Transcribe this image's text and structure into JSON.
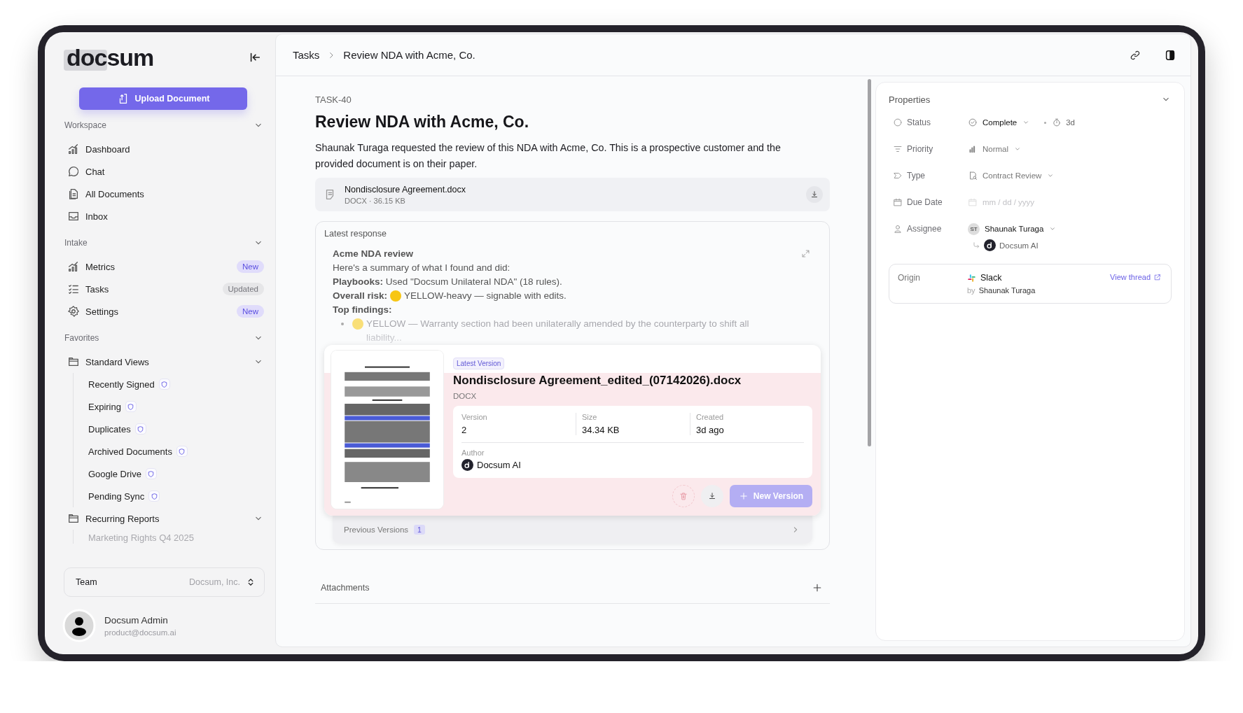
{
  "sidebar": {
    "logo": "docsum",
    "upload_button": "Upload Document",
    "sections": [
      {
        "title": "Workspace",
        "expanded": true,
        "items": [
          {
            "label": "Dashboard"
          },
          {
            "label": "Chat"
          },
          {
            "label": "All Documents"
          },
          {
            "label": "Inbox"
          }
        ]
      },
      {
        "title": "Intake",
        "expanded": true,
        "items": [
          {
            "label": "Metrics",
            "badge": {
              "text": "New",
              "kind": "new"
            }
          },
          {
            "label": "Tasks",
            "badge": {
              "text": "Updated",
              "kind": "updated"
            }
          },
          {
            "label": "Settings",
            "badge": {
              "text": "New",
              "kind": "new"
            }
          }
        ]
      }
    ],
    "favorites": {
      "title": "Favorites",
      "expanded": true,
      "groups": [
        {
          "label": "Standard Views",
          "expanded": true,
          "children": [
            {
              "label": "Recently Signed"
            },
            {
              "label": "Expiring"
            },
            {
              "label": "Duplicates"
            },
            {
              "label": "Archived Documents"
            },
            {
              "label": "Google Drive"
            },
            {
              "label": "Pending Sync"
            }
          ]
        },
        {
          "label": "Recurring Reports",
          "expanded": true,
          "children": [
            {
              "label": "Marketing Rights Q4 2025"
            }
          ]
        }
      ]
    },
    "team": {
      "label": "Team",
      "value": "Docsum, Inc."
    },
    "user": {
      "name": "Docsum Admin",
      "email": "product@docsum.ai"
    }
  },
  "breadcrumbs": [
    "Tasks",
    "Review NDA with Acme, Co."
  ],
  "task": {
    "id": "TASK-40",
    "title": "Review NDA with Acme, Co.",
    "description": "Shaunak Turaga requested the review of this NDA with Acme, Co. This is a prospective customer and the provided document is on their paper.",
    "attachment": {
      "name": "Nondisclosure Agreement.docx",
      "meta": "DOCX · 36.15 KB"
    }
  },
  "response": {
    "label": "Latest response",
    "title": "Acme NDA review",
    "intro": "Here's a summary of what I found and did:",
    "playbooks": "**Playbooks:** Used \"Docsum Unilateral NDA\" (18 rules).",
    "risk": {
      "label": "Overall risk:",
      "color": "#f7c614",
      "text": "YELLOW-heavy — signable with edits."
    },
    "findings_label": "Top findings:",
    "findings": [
      {
        "color": "#f9df78",
        "text": "YELLOW — Warranty section had been unilaterally amended by the counterparty to shift all liability..."
      }
    ]
  },
  "version": {
    "badge": "Latest Version",
    "filename": "Nondisclosure Agreement_edited_(07142026).docx",
    "type": "DOCX",
    "fields": [
      {
        "label": "Version",
        "value": "2"
      },
      {
        "label": "Size",
        "value": "34.34 KB"
      },
      {
        "label": "Created",
        "value": "3d ago"
      }
    ],
    "author": {
      "label": "Author",
      "name": "Docsum AI"
    },
    "new_button": "New Version",
    "previous": {
      "label": "Previous Versions",
      "count": "1",
      "expanded": false
    }
  },
  "attachments": {
    "label": "Attachments"
  },
  "properties": {
    "title": "Properties",
    "expanded": true,
    "rows": [
      {
        "kind": "status",
        "label": "Status",
        "value": "Complete",
        "age": "3d"
      },
      {
        "kind": "priority",
        "label": "Priority",
        "value": "Normal"
      },
      {
        "kind": "type",
        "label": "Type",
        "value": "Contract Review"
      },
      {
        "kind": "date",
        "label": "Due Date",
        "placeholder": "mm / dd / yyyy"
      },
      {
        "kind": "assignee",
        "label": "Assignee",
        "initials": "ST",
        "value": "Shaunak Turaga",
        "delegate": "Docsum AI"
      }
    ],
    "origin": {
      "label": "Origin",
      "source": "Slack",
      "by": "by",
      "author": "Shaunak Turaga",
      "link": "View thread"
    }
  }
}
